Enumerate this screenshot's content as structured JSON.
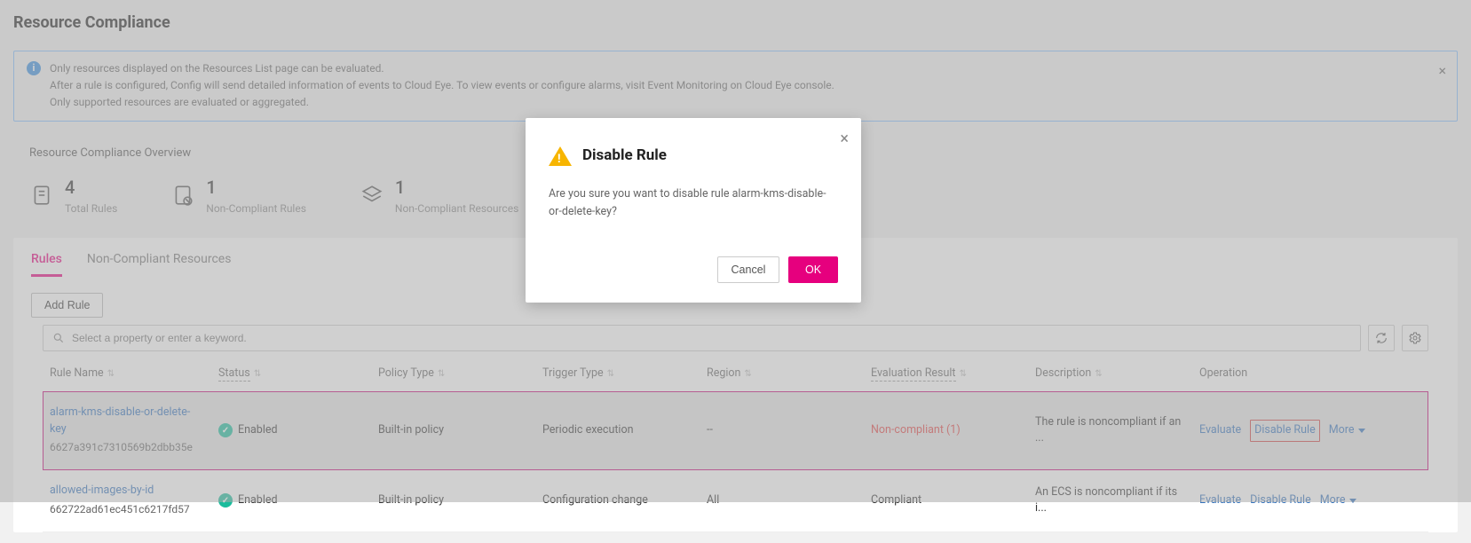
{
  "page": {
    "title": "Resource Compliance"
  },
  "banner": {
    "line1": "Only resources displayed on the Resources List page can be evaluated.",
    "line2": "After a rule is configured, Config will send detailed information of events to Cloud Eye. To view events or configure alarms, visit Event Monitoring on Cloud Eye console.",
    "line3": "Only supported resources are evaluated or aggregated."
  },
  "overview": {
    "title": "Resource Compliance Overview",
    "stats": [
      {
        "value": "4",
        "label": "Total Rules"
      },
      {
        "value": "1",
        "label": "Non-Compliant Rules"
      },
      {
        "value": "1",
        "label": "Non-Compliant Resources"
      }
    ]
  },
  "tabs": {
    "rules": "Rules",
    "ncr": "Non-Compliant Resources"
  },
  "toolbar": {
    "add_rule": "Add Rule"
  },
  "search": {
    "placeholder": "Select a property or enter a keyword."
  },
  "table": {
    "headers": {
      "rule_name": "Rule Name",
      "status": "Status",
      "policy_type": "Policy Type",
      "trigger_type": "Trigger Type",
      "region": "Region",
      "evaluation_result": "Evaluation Result",
      "description": "Description",
      "operation": "Operation"
    },
    "ops": {
      "evaluate": "Evaluate",
      "disable": "Disable Rule",
      "more": "More"
    },
    "rows": [
      {
        "name": "alarm-kms-disable-or-delete-key",
        "id": "6627a391c7310569b2dbb35e",
        "status": "Enabled",
        "policy_type": "Built-in policy",
        "trigger": "Periodic execution",
        "region": "--",
        "result": "Non-compliant (1)",
        "result_nc": true,
        "description": "The rule is noncompliant if an ..."
      },
      {
        "name": "allowed-images-by-id",
        "id": "662722ad61ec451c6217fd57",
        "status": "Enabled",
        "policy_type": "Built-in policy",
        "trigger": "Configuration change",
        "region": "All",
        "result": "Compliant",
        "result_nc": false,
        "description": "An ECS is noncompliant if its i..."
      }
    ]
  },
  "modal": {
    "title": "Disable Rule",
    "body": "Are you sure you want to disable rule alarm-kms-disable-or-delete-key?",
    "cancel": "Cancel",
    "ok": "OK"
  }
}
